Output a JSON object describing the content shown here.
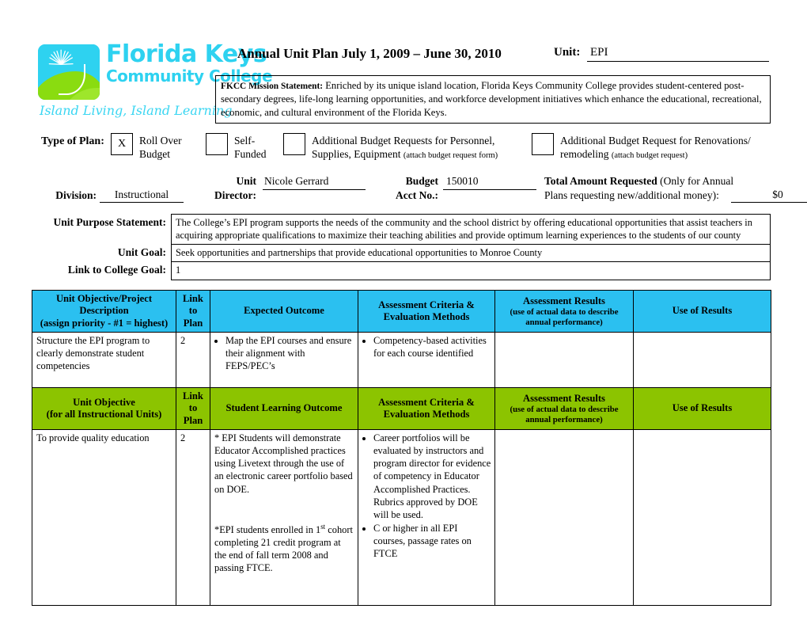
{
  "header": {
    "logo": {
      "line1": "Florida Keys",
      "line2": "Community College",
      "tagline": "Island Living, Island Learning",
      "cyan": "#2ED2F0",
      "green": "#8ADC10"
    },
    "doc_title": "Annual Unit Plan July 1, 2009 – June 30, 2010",
    "unit_label": "Unit:",
    "unit_value": "EPI",
    "mission_label": "FKCC Mission Statement:",
    "mission_text": " Enriched by its unique island location, Florida Keys Community College provides student-centered post-secondary degrees, life-long learning opportunities, and workforce development initiatives which enhance the educational, recreational, economic, and cultural environment of the Florida Keys."
  },
  "plan_type": {
    "label": "Type of Plan:",
    "options": [
      {
        "checked": "X",
        "text_line1": "Roll Over",
        "text_line2": "Budget",
        "note": ""
      },
      {
        "checked": "",
        "text_line1": "Self-",
        "text_line2": "Funded",
        "note": ""
      },
      {
        "checked": "",
        "text_line1": "Additional Budget Requests for Personnel,",
        "text_line2": "Supplies, Equipment",
        "note": "(attach budget request form)"
      },
      {
        "checked": "",
        "text_line1": "Additional Budget Request for Renovations/",
        "text_line2": "remodeling",
        "note": "(attach budget request)"
      }
    ]
  },
  "division_row": {
    "division_label": "Division:",
    "division_value": "Instructional",
    "unit_director_label_l1": "Unit",
    "unit_director_label_l2": "Director:",
    "unit_director_value": "Nicole Gerrard",
    "budget_acct_label_l1": "Budget",
    "budget_acct_label_l2": "Acct No.:",
    "budget_acct_value": "150010",
    "total_label_bold": "Total Amount Requested",
    "total_label_rest": " (Only for Annual",
    "total_label_l2": "Plans requesting new/additional money):",
    "total_value": "$0"
  },
  "purpose": {
    "rows": [
      {
        "label": "Unit Purpose Statement:",
        "value": "The College’s EPI program supports the needs of the community and the school district by offering educational opportunities that assist teachers in acquiring appropriate qualifications to maximize their teaching abilities and provide optimum learning experiences to the students of our county"
      },
      {
        "label": "Unit Goal:",
        "value": "Seek opportunities and partnerships that provide educational opportunities to Monroe County"
      },
      {
        "label": "Link to College Goal:",
        "value": "1"
      }
    ]
  },
  "table_objectives": {
    "accent": "#2BC0F0",
    "headers": {
      "c1_l1": "Unit Objective/Project",
      "c1_l2": "Description",
      "c1_l3": "(assign priority - #1 = highest)",
      "c2_l1": "Link",
      "c2_l2": "to",
      "c2_l3": "Plan",
      "c3": "Expected Outcome",
      "c4_l1": "Assessment Criteria &",
      "c4_l2": "Evaluation Methods",
      "c5_l1": "Assessment Results",
      "c5_sub1": "(use of actual data to describe",
      "c5_sub2": "annual performance)",
      "c6": "Use of Results"
    },
    "rows": [
      {
        "objective": "Structure the EPI program to clearly demonstrate student competencies",
        "link": "2",
        "expected_outcome": [
          "Map the EPI courses and ensure their alignment with FEPS/PEC’s"
        ],
        "criteria": [
          "Competency-based activities for each course identified"
        ],
        "results": "",
        "use_of_results": ""
      }
    ]
  },
  "table_slo": {
    "accent": "#8CC400",
    "headers": {
      "c1_l1": "Unit Objective",
      "c1_l2": "(for all Instructional Units)",
      "c2_l1": "Link",
      "c2_l2": "to",
      "c2_l3": "Plan",
      "c3": "Student Learning Outcome",
      "c4_l1": "Assessment Criteria &",
      "c4_l2": "Evaluation Methods",
      "c5_l1": "Assessment Results",
      "c5_sub1": "(use of actual data to describe",
      "c5_sub2": "annual performance)",
      "c6": "Use of Results"
    },
    "rows": [
      {
        "objective": "To provide quality education",
        "link": "2",
        "slo_p1": "* EPI Students will demonstrate Educator Accomplished practices using Livetext through the use of an electronic career portfolio based on DOE.",
        "slo_p2_pre": "*EPI students enrolled in 1",
        "slo_p2_sup": "st",
        "slo_p2_post": " cohort completing 21 credit program at the end of fall term 2008 and passing FTCE.",
        "criteria": [
          "Career portfolios will be evaluated by instructors and program director for evidence of competency in Educator Accomplished Practices. Rubrics approved by DOE will be used.",
          "C or higher in all EPI courses, passage rates on FTCE"
        ],
        "results": "",
        "use_of_results": ""
      }
    ]
  }
}
